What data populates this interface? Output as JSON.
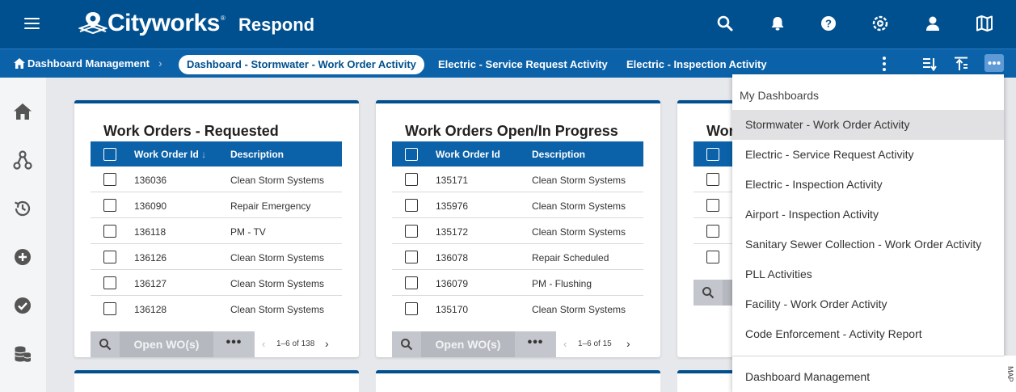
{
  "header": {
    "logo_text": "Cityworks",
    "logo_tm": "®",
    "app_name": "Respond"
  },
  "breadcrumb": {
    "home_label": "Dashboard Management",
    "separator": "›"
  },
  "tabs": [
    {
      "label": "Dashboard - Stormwater - Work Order Activity",
      "active": true
    },
    {
      "label": "Electric - Service Request Activity",
      "active": false
    },
    {
      "label": "Electric - Inspection Activity",
      "active": false
    }
  ],
  "cards": [
    {
      "title": "Work Orders - Requested",
      "col_id": "Work Order Id",
      "col_id_sort": "↓",
      "col_desc": "Description",
      "rows": [
        {
          "id": "136036",
          "desc": "Clean Storm Systems"
        },
        {
          "id": "136090",
          "desc": "Repair Emergency"
        },
        {
          "id": "136118",
          "desc": "PM - TV"
        },
        {
          "id": "136126",
          "desc": "Clean Storm Systems"
        },
        {
          "id": "136127",
          "desc": "Clean Storm Systems"
        },
        {
          "id": "136128",
          "desc": "Clean Storm Systems"
        }
      ],
      "open_label": "Open WO(s)",
      "more_label": "•••",
      "prev": "‹",
      "pager": "1–6 of 138",
      "next": "›"
    },
    {
      "title": "Work Orders Open/In Progress",
      "col_id": "Work Order Id",
      "col_id_sort": "",
      "col_desc": "Description",
      "rows": [
        {
          "id": "135171",
          "desc": "Clean Storm Systems"
        },
        {
          "id": "135976",
          "desc": "Clean Storm Systems"
        },
        {
          "id": "135172",
          "desc": "Clean Storm Systems"
        },
        {
          "id": "136078",
          "desc": "Repair Scheduled"
        },
        {
          "id": "136079",
          "desc": "PM - Flushing"
        },
        {
          "id": "135170",
          "desc": "Clean Storm Systems"
        }
      ],
      "open_label": "Open WO(s)",
      "more_label": "•••",
      "prev": "‹",
      "pager": "1–6 of 15",
      "next": "›"
    },
    {
      "title": "Wor"
    }
  ],
  "dropdown": {
    "header": "My Dashboards",
    "items": [
      {
        "label": "Stormwater - Work Order Activity",
        "selected": true
      },
      {
        "label": "Electric - Service Request Activity",
        "selected": false
      },
      {
        "label": "Electric - Inspection Activity",
        "selected": false
      },
      {
        "label": "Airport - Inspection Activity",
        "selected": false
      },
      {
        "label": "Sanitary Sewer Collection - Work Order Activity",
        "selected": false
      },
      {
        "label": "PLL Activities",
        "selected": false
      },
      {
        "label": "Facility - Work Order Activity",
        "selected": false
      },
      {
        "label": "Code Enforcement - Activity Report",
        "selected": false
      }
    ],
    "manage_label": "Dashboard Management"
  },
  "map_tab": "MAP",
  "icons": {
    "top": [
      "search-icon",
      "bell-icon",
      "help-icon",
      "settings-icon",
      "user-icon",
      "map-icon"
    ],
    "sidebar": [
      "home-icon",
      "workflow-icon",
      "history-icon",
      "add-icon",
      "check-icon",
      "database-icon"
    ]
  },
  "colors": {
    "header": "#00508f",
    "nav": "#0b62a9",
    "accent": "#5e9bd6"
  }
}
